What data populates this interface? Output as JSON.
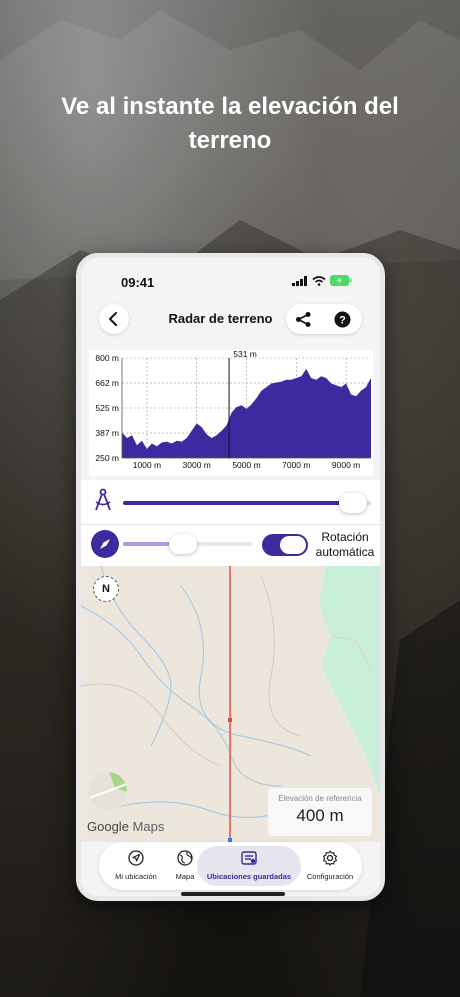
{
  "headline": "Ve al instante la elevación del terreno",
  "status": {
    "time": "09:41"
  },
  "header": {
    "title": "Radar de terreno",
    "back_icon": "chevron-left-icon",
    "share_icon": "share-icon",
    "help_icon": "help-icon"
  },
  "colors": {
    "accent": "#3e2a9e",
    "fill": "#3e2a9e",
    "slider_light": "#a99ddb",
    "map_bg": "#ece6dc",
    "map_green": "#c8efd9",
    "profile_line": "#e8776a"
  },
  "chart_data": {
    "type": "area",
    "cursor_label": "531 m",
    "cursor_x": 4300,
    "y_ticks": [
      "800 m",
      "662 m",
      "525 m",
      "387 m",
      "250 m"
    ],
    "y_tick_values": [
      800,
      662,
      525,
      387,
      250
    ],
    "x_ticks": [
      "1000 m",
      "3000 m",
      "5000 m",
      "7000 m",
      "9000 m"
    ],
    "x_tick_values": [
      1000,
      3000,
      5000,
      7000,
      9000
    ],
    "xlim": [
      0,
      10000
    ],
    "ylim": [
      250,
      800
    ],
    "x": [
      0,
      200,
      400,
      600,
      800,
      1000,
      1200,
      1400,
      1600,
      1800,
      2000,
      2200,
      2400,
      2600,
      2800,
      3000,
      3200,
      3400,
      3600,
      3800,
      4000,
      4200,
      4400,
      4600,
      4800,
      5000,
      5200,
      5400,
      5600,
      5800,
      6000,
      6200,
      6400,
      6600,
      6800,
      7000,
      7200,
      7400,
      7600,
      7800,
      8000,
      8200,
      8400,
      8600,
      8800,
      9000,
      9200,
      9400,
      9600,
      9800,
      10000
    ],
    "y": [
      390,
      360,
      375,
      320,
      345,
      300,
      330,
      315,
      335,
      340,
      330,
      345,
      340,
      360,
      400,
      440,
      420,
      380,
      360,
      375,
      400,
      430,
      500,
      530,
      540,
      520,
      545,
      580,
      620,
      640,
      660,
      665,
      670,
      680,
      680,
      690,
      700,
      740,
      690,
      680,
      700,
      690,
      660,
      650,
      640,
      660,
      600,
      590,
      620,
      640,
      690
    ]
  },
  "sliders": {
    "compass_icon": "compass-icon",
    "caliper_icon": "caliper-icon",
    "range_fraction": 0.98,
    "rotation_fraction": 0.45,
    "toggle_label_1": "Rotación",
    "toggle_label_2": "automática",
    "toggle_on": true
  },
  "map": {
    "north_label": "N",
    "ref_label": "Elevación de referencia",
    "ref_value": "400 m",
    "gmaps_google": "Google",
    "gmaps_maps": "Maps"
  },
  "nav": [
    {
      "label": "Mi ubicación",
      "icon": "navigation-arrow-icon",
      "active": false
    },
    {
      "label": "Mapa",
      "icon": "globe-icon",
      "active": false
    },
    {
      "label": "Ubicaciones guardadas",
      "icon": "saved-list-icon",
      "active": true
    },
    {
      "label": "Configuración",
      "icon": "gear-icon",
      "active": false
    }
  ]
}
